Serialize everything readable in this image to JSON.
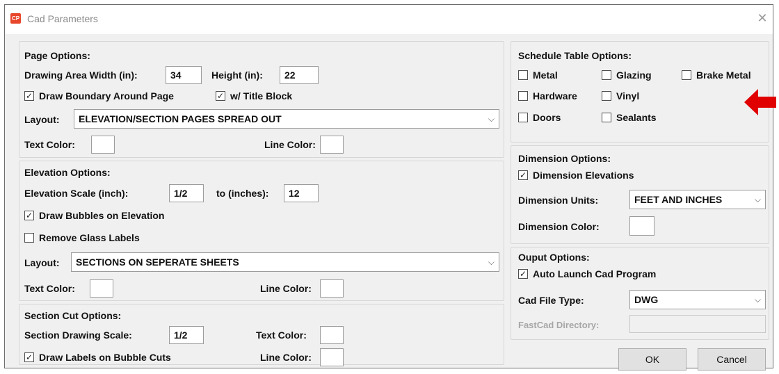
{
  "window": {
    "title": "Cad Parameters",
    "app_icon_text": "CP",
    "close_symbol": "✕"
  },
  "page_options": {
    "heading": "Page Options:",
    "width_label": "Drawing Area Width (in):",
    "width_value": "34",
    "height_label": "Height (in):",
    "height_value": "22",
    "draw_boundary": {
      "label": "Draw Boundary Around Page",
      "checked": true
    },
    "title_block": {
      "label": "w/ Title Block",
      "checked": true
    },
    "layout_label": "Layout:",
    "layout_value": "ELEVATION/SECTION PAGES SPREAD OUT",
    "text_color_label": "Text Color:",
    "line_color_label": "Line Color:"
  },
  "elevation_options": {
    "heading": "Elevation Options:",
    "scale_label": "Elevation Scale (inch):",
    "scale_value": "1/2",
    "to_label": "to (inches):",
    "to_value": "12",
    "draw_bubbles": {
      "label": "Draw Bubbles on Elevation",
      "checked": true
    },
    "remove_glass": {
      "label": "Remove Glass Labels",
      "checked": false
    },
    "layout_label": "Layout:",
    "layout_value": "SECTIONS ON SEPERATE SHEETS",
    "text_color_label": "Text Color:",
    "line_color_label": "Line Color:"
  },
  "section_cut_options": {
    "heading": "Section Cut Options:",
    "scale_label": "Section Drawing Scale:",
    "scale_value": "1/2",
    "text_color_label": "Text Color:",
    "draw_labels": {
      "label": "Draw Labels on Bubble Cuts",
      "checked": true
    },
    "line_color_label": "Line Color:"
  },
  "schedule_table_options": {
    "heading": "Schedule Table Options:",
    "items": [
      {
        "label": "Metal",
        "checked": false
      },
      {
        "label": "Glazing",
        "checked": false
      },
      {
        "label": "Brake Metal",
        "checked": false
      },
      {
        "label": "Hardware",
        "checked": false
      },
      {
        "label": "Vinyl",
        "checked": false
      },
      {
        "label": "Doors",
        "checked": false
      },
      {
        "label": "Sealants",
        "checked": false
      }
    ]
  },
  "dimension_options": {
    "heading": "Dimension Options:",
    "dimension_elevations": {
      "label": "Dimension Elevations",
      "checked": true
    },
    "units_label": "Dimension Units:",
    "units_value": "FEET AND INCHES",
    "color_label": "Dimension Color:"
  },
  "output_options": {
    "heading": "Ouput Options:",
    "auto_launch": {
      "label": "Auto Launch Cad Program",
      "checked": true
    },
    "file_type_label": "Cad File Type:",
    "file_type_value": "DWG",
    "fastcad_label": "FastCad Directory:",
    "fastcad_value": ""
  },
  "buttons": {
    "ok": "OK",
    "cancel": "Cancel"
  },
  "icons": {
    "check_mark": "✓",
    "dropdown_caret": "⌵"
  },
  "colors": {
    "annotation_arrow": "#e00000",
    "app_icon": "#e8462b"
  }
}
